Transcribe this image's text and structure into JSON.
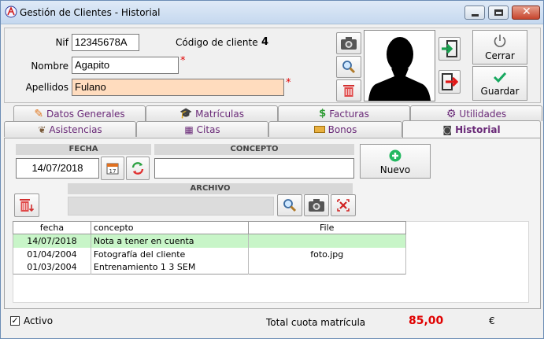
{
  "window": {
    "title": "Gestión de Clientes - Historial"
  },
  "form": {
    "nif_label": "Nif",
    "nif_value": "12345678A",
    "codigo_label": "Código de cliente",
    "codigo_value": "4",
    "nombre_label": "Nombre",
    "nombre_value": "Agapito",
    "apellidos_label": "Apellidos",
    "apellidos_value": "Fulano",
    "required_mark": "*"
  },
  "actions": {
    "cerrar": "Cerrar",
    "guardar": "Guardar"
  },
  "tabs_row1": [
    {
      "label": "Datos Generales",
      "icon": "pen-icon"
    },
    {
      "label": "Matrículas",
      "icon": "graduation-cap-icon"
    },
    {
      "label": "Facturas",
      "icon": "money-icon"
    },
    {
      "label": "Utilidades",
      "icon": "gear-icon"
    }
  ],
  "tabs_row2": [
    {
      "label": "Asistencias",
      "icon": "footprints-icon"
    },
    {
      "label": "Citas",
      "icon": "calendar-icon"
    },
    {
      "label": "Bonos",
      "icon": "ticket-icon"
    },
    {
      "label": "Historial",
      "icon": "camera-icon",
      "active": true
    }
  ],
  "historial": {
    "fecha_header": "FECHA",
    "fecha_value": "14/07/2018",
    "concepto_header": "CONCEPTO",
    "concepto_value": "",
    "archivo_header": "ARCHIVO",
    "archivo_value": "",
    "nuevo_label": "Nuevo",
    "columns": [
      "fecha",
      "concepto",
      "File"
    ],
    "rows": [
      {
        "fecha": "14/07/2018",
        "concepto": "Nota a tener en cuenta",
        "file": "",
        "selected": true
      },
      {
        "fecha": "01/04/2004",
        "concepto": "Fotografía del cliente",
        "file": "foto.jpg",
        "selected": false
      },
      {
        "fecha": "01/03/2004",
        "concepto": "Entrenamiento 1 3 SEM",
        "file": "",
        "selected": false
      }
    ]
  },
  "status": {
    "activo_label": "Activo",
    "activo_checked": true,
    "total_label": "Total cuota matrícula",
    "total_value": "85,00",
    "currency": "€"
  },
  "colors": {
    "accent_purple": "#6a2a78",
    "total_red": "#e00000",
    "selected_row": "#c8f5c8",
    "peach_field": "#ffdcbe"
  }
}
